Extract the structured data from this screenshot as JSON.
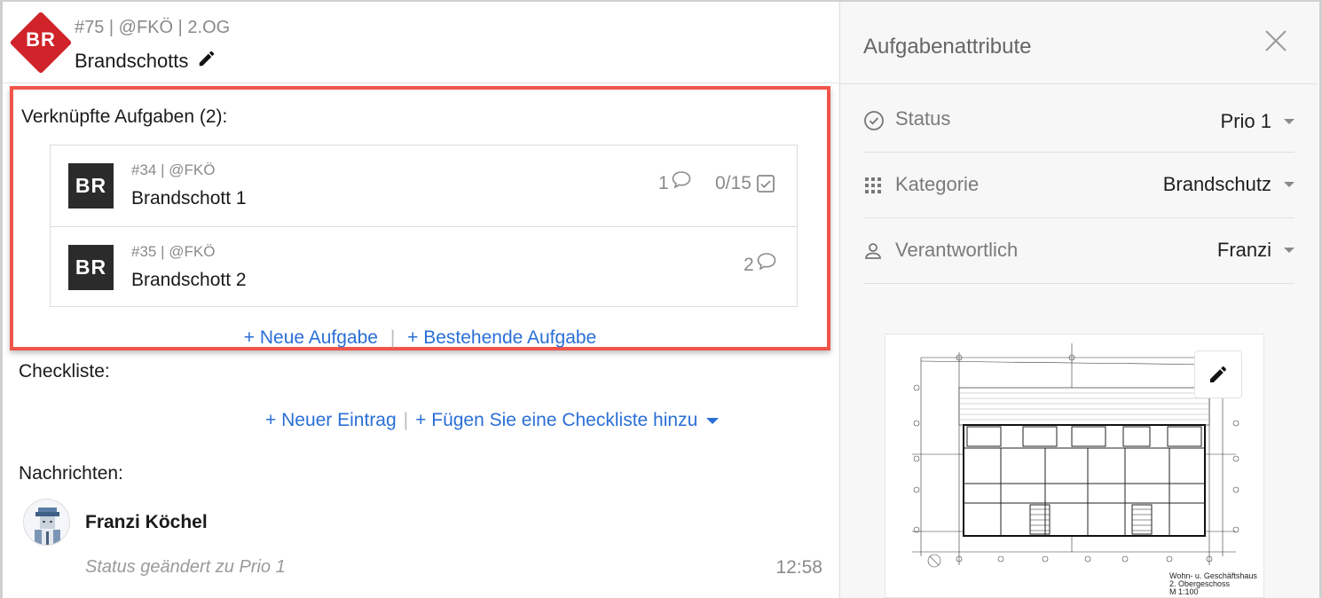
{
  "task": {
    "badge": "BR",
    "meta": "#75 | @FKÖ | 2.OG",
    "title": "Brandschotts"
  },
  "linked": {
    "title": "Verknüpfte Aufgaben (2):",
    "items": [
      {
        "badge": "BR",
        "meta": "#34 | @FKÖ",
        "name": "Brandschott 1",
        "comments": "1",
        "checklist": "0/15"
      },
      {
        "badge": "BR",
        "meta": "#35 | @FKÖ",
        "name": "Brandschott 2",
        "comments": "2"
      }
    ],
    "new_task": "+ Neue Aufgabe",
    "existing_task": "+ Bestehende Aufgabe",
    "separator": "|"
  },
  "checklist": {
    "title": "Checkliste:",
    "new_entry": "+ Neuer Eintrag",
    "add_checklist": "+ Fügen Sie eine Checkliste hinzu",
    "separator": "|"
  },
  "messages": {
    "title": "Nachrichten:",
    "items": [
      {
        "user": "Franzi Köchel",
        "text": "Status geändert zu Prio 1",
        "time": "12:58"
      }
    ]
  },
  "attributes": {
    "title": "Aufgabenattribute",
    "status_label": "Status",
    "status_value": "Prio 1",
    "category_label": "Kategorie",
    "category_value": "Brandschutz",
    "responsible_label": "Verantwortlich",
    "responsible_value": "Franzi"
  },
  "plan": {
    "caption_line1": "Wohn- u. Geschäftshaus",
    "caption_line2": "2. Obergeschoss",
    "caption_line3": "M 1:100"
  },
  "colors": {
    "accent": "#2a6fd6",
    "brand_red": "#d0232a",
    "highlight": "#f0554a",
    "badge_dark": "#2b2b2b"
  }
}
